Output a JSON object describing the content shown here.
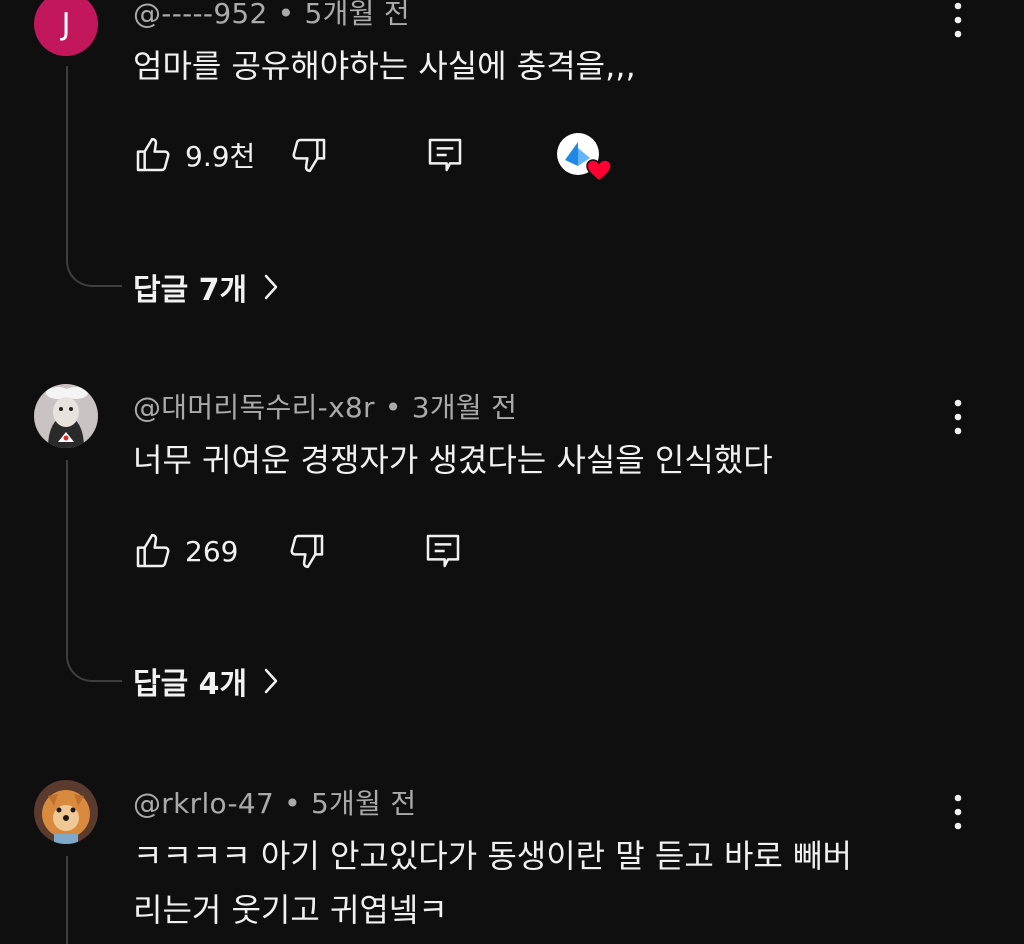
{
  "comments": [
    {
      "avatar_letter": "J",
      "author": "@-----952",
      "time": "5개월 전",
      "text_lines": [
        "엄마를 공유해야하는 사실에 충격을,,,"
      ],
      "likes": "9.9천",
      "replies_label": "답글 7개",
      "creator_heart": true
    },
    {
      "author": "@대머리독수리-x8r",
      "time": "3개월 전",
      "text_lines": [
        "너무 귀여운 경쟁자가 생겼다는 사실을 인식했다"
      ],
      "likes": "269",
      "replies_label": "답글 4개"
    },
    {
      "author": "@rkrlo-47",
      "time": "5개월 전",
      "text_lines": [
        "ㅋㅋㅋㅋ 아기 안고있다가 동생이란 말 듣고 바로 빼버",
        "리는거 웃기고 귀엽넼ㅋ"
      ]
    }
  ],
  "separator": "•",
  "colors": {
    "background": "#0f0f0f",
    "text": "#f1f1f1",
    "meta": "#aaaaaa",
    "thread_line": "#3e3e3e",
    "avatar_j": "#c2185b",
    "heart": "#ff0033"
  },
  "icons": [
    "like-icon",
    "dislike-icon",
    "reply-icon",
    "kebab-menu-icon",
    "chevron-right-icon",
    "heart-icon"
  ]
}
